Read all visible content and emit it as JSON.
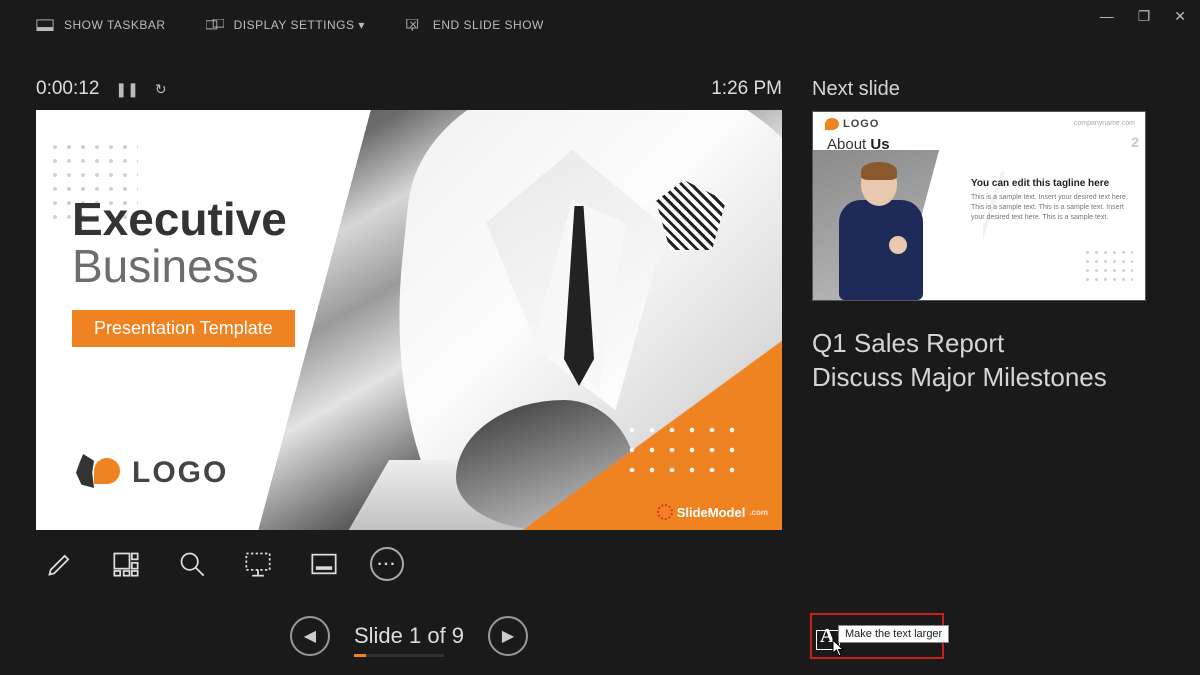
{
  "window": {
    "minimize": "—",
    "restore": "❐",
    "close": "✕"
  },
  "topbar": {
    "show_taskbar": "SHOW TASKBAR",
    "display_settings": "DISPLAY SETTINGS ▾",
    "end_slide_show": "END SLIDE SHOW"
  },
  "timer": {
    "elapsed": "0:00:12",
    "pause_glyph": "❚❚",
    "reset_glyph": "↻",
    "clock": "1:26 PM"
  },
  "current_slide": {
    "title_line1": "Executive",
    "title_line2": "Business",
    "tagline": "Presentation Template",
    "logo_text": "LOGO",
    "watermark": "SlideModel",
    "watermark_suffix": ".com"
  },
  "tools": {
    "pen": "pen-icon",
    "all_slides": "all-slides-icon",
    "zoom": "zoom-icon",
    "black_screen": "laser-icon",
    "subtitles": "subtitles-icon",
    "more": "..."
  },
  "nav": {
    "prev": "◀",
    "next": "▶",
    "counter": "Slide 1 of 9"
  },
  "right": {
    "heading": "Next slide",
    "thumb": {
      "logo": "LOGO",
      "company": "companyname.com",
      "title_a": "About",
      "title_b": "Us",
      "slide_number": "2",
      "tag_heading": "You can edit this tagline here",
      "tag_body": "This is a sample text. Insert your desired text here. This is a sample text. This is a sample text. Insert your desired text here. This is a sample text."
    },
    "notes_line1": "Q1 Sales Report",
    "notes_line2": "Discuss Major Milestones"
  },
  "text_size": {
    "big": "A",
    "small": "A",
    "tooltip": "Make the text larger"
  }
}
